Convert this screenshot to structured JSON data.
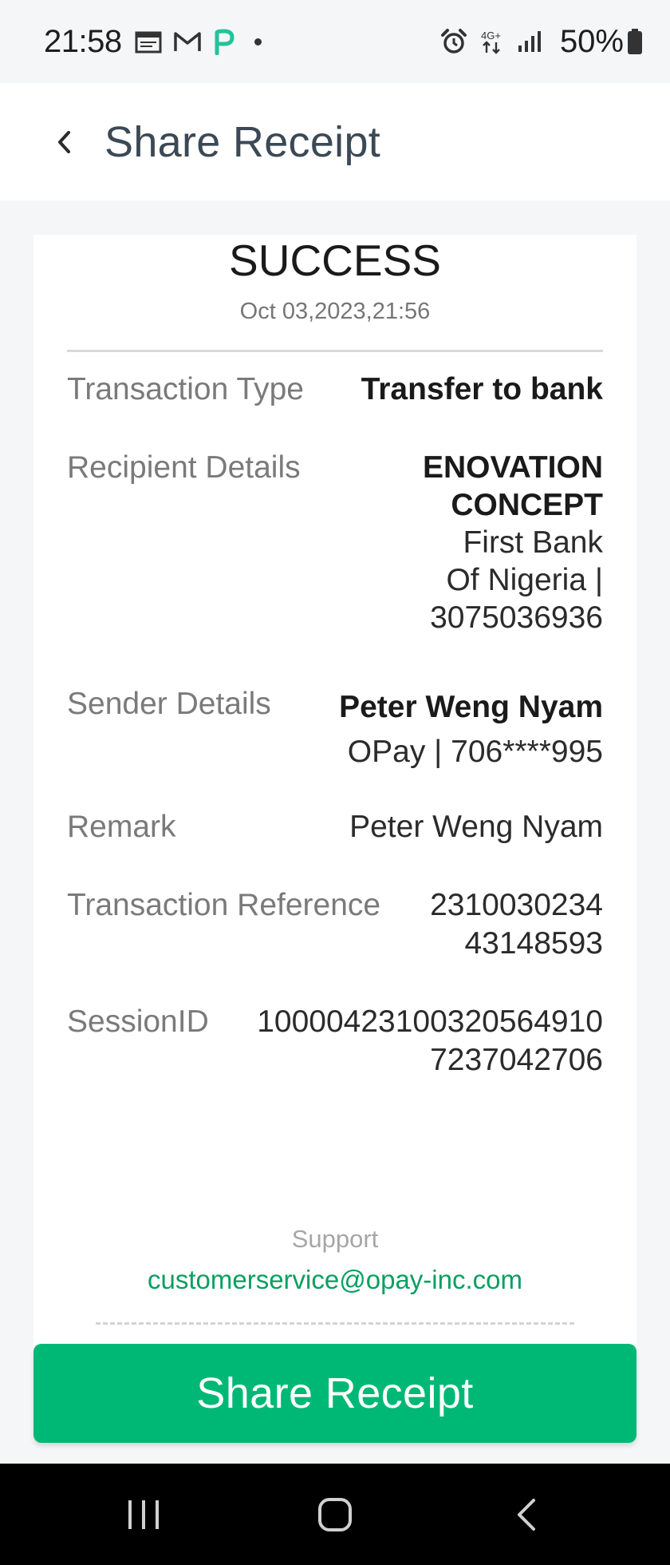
{
  "status_bar": {
    "time": "21:58",
    "icons_left": [
      "calendar-icon",
      "gmail-icon",
      "p-app-icon",
      "dot-icon"
    ],
    "icons_right": [
      "alarm-icon",
      "4g-data-icon",
      "signal-icon",
      "battery-icon"
    ],
    "network": "4G+",
    "battery": "50%"
  },
  "app_bar": {
    "title": "Share Receipt"
  },
  "receipt": {
    "status": "SUCCESS",
    "date": "Oct 03,2023,21:56",
    "rows": [
      {
        "label": "Transaction Type",
        "value": "Transfer to bank"
      },
      {
        "label": "Recipient Details",
        "name_line1": "ENOVATION",
        "name_line2": "CONCEPT",
        "bank_line1": "First Bank",
        "bank_line2": "Of Nigeria |",
        "account": "3075036936"
      },
      {
        "label": "Sender Details",
        "name": "Peter Weng Nyam",
        "account": "OPay | 706****995"
      },
      {
        "label": "Remark",
        "value": "Peter Weng Nyam"
      },
      {
        "label": "Transaction Reference",
        "value_line1": "2310030234",
        "value_line2": "43148593"
      },
      {
        "label": "SessionID",
        "value_line1": "10000423100320564910",
        "value_line2": "7237042706"
      }
    ],
    "support_label": "Support",
    "support_email": "customerservice@opay-inc.com"
  },
  "share_button": {
    "label": "Share Receipt"
  },
  "colors": {
    "accent_green": "#00b876",
    "email_green": "#0a9f61",
    "background": "#f5f6f8"
  }
}
